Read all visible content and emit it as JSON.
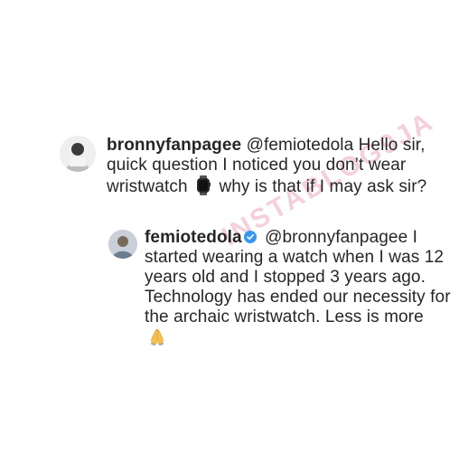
{
  "comments": [
    {
      "username": "bronnyfanpagee",
      "text_before_icon": " @femiotedola Hello sir, quick question I noticed you don’t wear wristwatch ",
      "icon": "watch-icon",
      "text_after_icon": " why is that if I may ask sir?"
    },
    {
      "username": "femiotedola",
      "verified_icon": "verified-badge-icon",
      "text_before_icon": " @bronnyfanpagee I started wearing a watch when I was 12 years old and I stopped 3 years ago. Technology has ended our necessity for the archaic wristwatch. Less is more ",
      "icon": "folded-hands-icon"
    }
  ],
  "watermark": "INSTABLOG9JA",
  "colors": {
    "text": "#262626",
    "verified": "#3897f0",
    "watermark": "#e37896"
  }
}
